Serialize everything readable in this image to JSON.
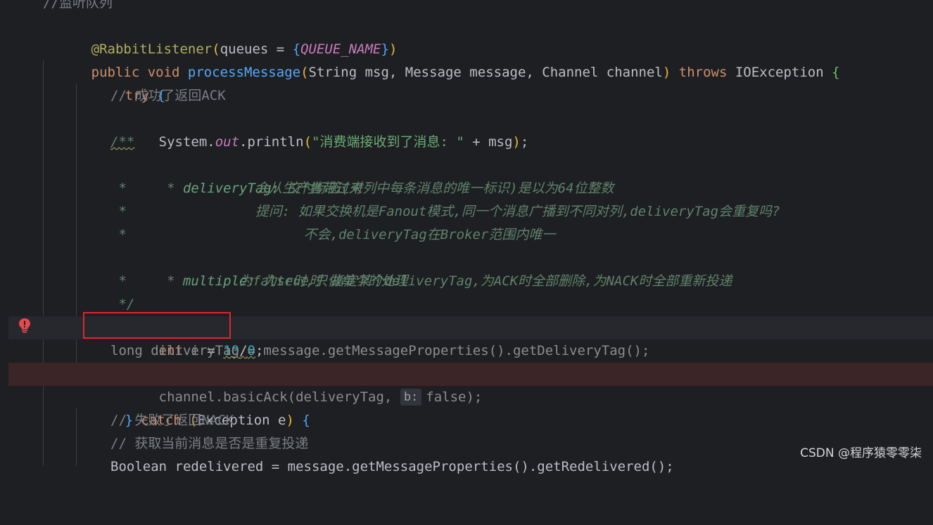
{
  "editor": {
    "lines": {
      "l0_comment": "//监听队列",
      "l1_annotation": "@RabbitListener",
      "l1_paren_open": "(",
      "l1_param": "queues = ",
      "l1_brace_open": "{",
      "l1_const": "QUEUE_NAME",
      "l1_brace_close": "}",
      "l1_paren_close": ")",
      "l2_public": "public",
      "l2_void": " void ",
      "l2_method": "processMessage",
      "l2_paren_open": "(",
      "l2_params": "String msg, Message message, Channel channel",
      "l2_paren_close": ")",
      "l2_throws": " throws ",
      "l2_exc": "IOException ",
      "l2_brace": "{",
      "l3_try": "try ",
      "l3_brace": "{",
      "l4_comment": "// 成功了返回ACK",
      "l5_system": "System.",
      "l5_out": "out",
      "l5_println": ".println",
      "l5_paren_open": "(",
      "l5_string": "\"消费端接收到了消息: \"",
      "l5_plus": " + msg",
      "l5_paren_close": ")",
      "l5_semi": ";",
      "l6_doc_open": "/**",
      "l7_star": " * ",
      "l7_tag": "deliveryTag:",
      "l7_text": " 交付标签(对列中每条消息的唯一标识)是以为64位整数",
      "l8_text": " *                会从生产者带过来",
      "l9_text": " *                提问: 如果交换机是Fanout模式,同一个消息广播到不同对列,deliveryTag会重复吗?",
      "l10_text": " *                      不会,deliveryTag在Broker范围内唯一",
      "l11_star": " * ",
      "l11_tag": "multiple:",
      "l11_text": " 为true时 指定某个deliveryTag,为ACK时全部删除,为NACK时全部重新投递",
      "l12_text": " *              为false时,只做单个的处理",
      "l13_text": " */",
      "l14_int": "int ",
      "l14_var": "i",
      "l14_eq": " = ",
      "l14_num1": "10",
      "l14_div": "/",
      "l14_num2": "0",
      "l14_semi": ";",
      "l15_text": "long deliveryTag = message.getMessageProperties().getDeliveryTag();",
      "l16_pre": "channel.basicAck(deliveryTag, ",
      "l16_hint": "b:",
      "l16_post": "false);",
      "l17_close": "} ",
      "l17_catch": "catch ",
      "l17_paren_open": "(",
      "l17_exc": "Exception e",
      "l17_paren_close": ")",
      "l17_brace": " {",
      "l18_comment": "// 失败了返回NACK",
      "l19_comment": "// 获取当前消息是否是重复投递",
      "l20_text": "Boolean redelivered = message.getMessageProperties().getRedelivered();"
    }
  },
  "watermark": "CSDN @程序猿零零柒",
  "colors": {
    "background": "#1e1f22",
    "keyword": "#cf8e6d",
    "method": "#56a8f5",
    "string": "#6aab73",
    "number": "#2aacb8",
    "annotation": "#b3ae60",
    "highlight_box": "#e0262d"
  },
  "icons": {
    "gutter_error": "error-bulb-icon"
  }
}
